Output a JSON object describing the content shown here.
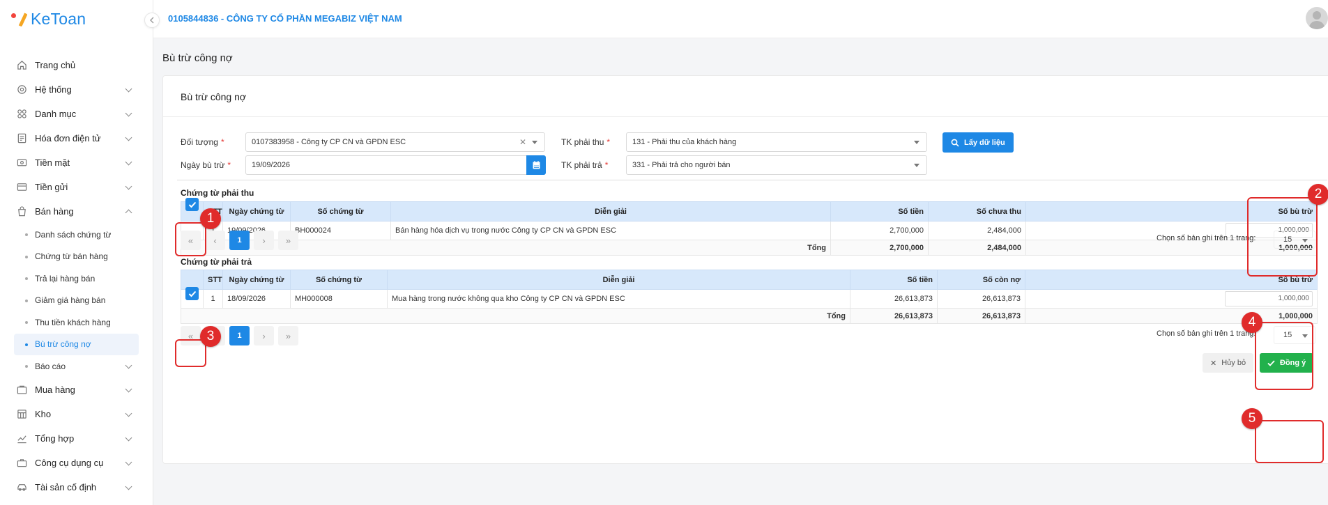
{
  "app": {
    "logo_text": "KeToan",
    "company": "0105844836 - CÔNG TY CỔ PHẦN MEGABIZ VIỆT NAM"
  },
  "sidebar": {
    "items": [
      {
        "label": "Trang chủ",
        "icon": "home-icon"
      },
      {
        "label": "Hệ thống",
        "icon": "gear-icon"
      },
      {
        "label": "Danh mục",
        "icon": "grid-icon"
      },
      {
        "label": "Hóa đơn điện tử",
        "icon": "invoice-icon"
      },
      {
        "label": "Tiền mặt",
        "icon": "cash-icon"
      },
      {
        "label": "Tiền gửi",
        "icon": "card-icon"
      },
      {
        "label": "Bán hàng",
        "icon": "bag-icon"
      }
    ],
    "sales_sub": [
      {
        "label": "Danh sách chứng từ"
      },
      {
        "label": "Chứng từ bán hàng"
      },
      {
        "label": "Trả lại hàng bán"
      },
      {
        "label": "Giảm giá hàng bán"
      },
      {
        "label": "Thu tiền khách hàng"
      },
      {
        "label": "Bù trừ công nợ"
      },
      {
        "label": "Báo cáo"
      }
    ],
    "items_after": [
      {
        "label": "Mua hàng",
        "icon": "cart-icon"
      },
      {
        "label": "Kho",
        "icon": "warehouse-icon"
      },
      {
        "label": "Tổng hợp",
        "icon": "chart-icon"
      },
      {
        "label": "Công cụ dụng cụ",
        "icon": "tools-icon"
      },
      {
        "label": "Tài sản cố định",
        "icon": "car-icon"
      }
    ]
  },
  "page": {
    "title": "Bù trừ công nợ",
    "card_title": "Bù trừ công nợ"
  },
  "form": {
    "doi_tuong_label": "Đối tượng",
    "doi_tuong_value": "0107383958 - Công ty CP CN và GPDN ESC",
    "ngay_label": "Ngày bù trừ",
    "ngay_value": "19/09/2026",
    "tk_thu_label": "TK phải thu",
    "tk_thu_value": "131 - Phải thu của khách hàng",
    "tk_tra_label": "TK phải trả",
    "tk_tra_value": "331 - Phải trả cho người bán",
    "fetch_label": "Lấy dữ liệu"
  },
  "receivable": {
    "title": "Chứng từ phải thu",
    "headers": [
      "STT",
      "Ngày chứng từ",
      "Số chứng từ",
      "Diễn giải",
      "Số tiền",
      "Số chưa thu",
      "Số bù trừ"
    ],
    "row": {
      "stt": "1",
      "date": "19/09/2026",
      "doc": "BH000024",
      "desc": "Bán hàng hóa dịch vụ trong nước Công ty CP CN và GPDN ESC",
      "amount": "2,700,000",
      "remaining": "2,484,000",
      "offset": "1,000,000"
    },
    "total": {
      "label": "Tổng",
      "amount": "2,700,000",
      "remaining": "2,484,000",
      "offset": "1,000,000"
    }
  },
  "payable": {
    "title": "Chứng từ phải trả",
    "headers": [
      "STT",
      "Ngày chứng từ",
      "Số chứng từ",
      "Diễn giải",
      "Số tiền",
      "Số còn nợ",
      "Số bù trừ"
    ],
    "row": {
      "stt": "1",
      "date": "18/09/2026",
      "doc": "MH000008",
      "desc": "Mua hàng trong nước không qua kho Công ty CP CN và GPDN ESC",
      "amount": "26,613,873",
      "remaining": "26,613,873",
      "offset": "1,000,000"
    },
    "total": {
      "label": "Tổng",
      "amount": "26,613,873",
      "remaining": "26,613,873",
      "offset": "1,000,000"
    }
  },
  "pagination": {
    "page": "1",
    "per_page_label": "Chọn số bản ghi trên 1 trang:",
    "per_page": "15"
  },
  "actions": {
    "cancel": "Hủy bỏ",
    "ok": "Đồng ý"
  },
  "annotations": [
    "1",
    "2",
    "3",
    "4",
    "5"
  ],
  "colors": {
    "primary": "#1e88e5",
    "success": "#22b14c",
    "annotation": "#e02b2b",
    "header_bg": "#d7e8fb"
  }
}
